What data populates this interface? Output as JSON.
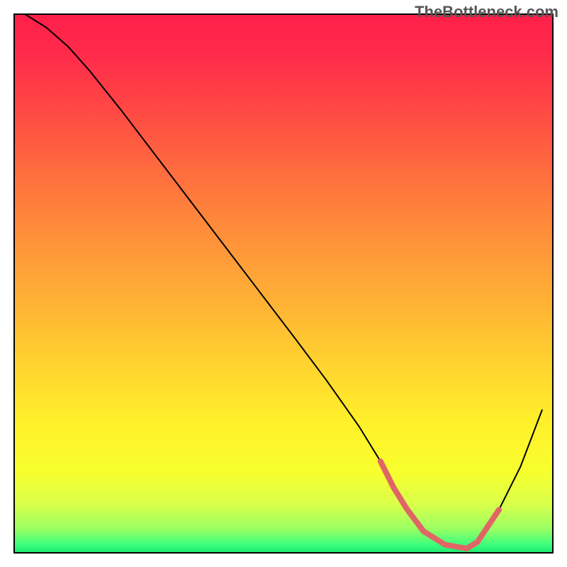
{
  "watermark": "TheBottleneck.com",
  "chart_data": {
    "type": "line",
    "title": "",
    "xlabel": "",
    "ylabel": "",
    "xlim": [
      0,
      100
    ],
    "ylim": [
      0,
      100
    ],
    "background_gradient_stops": [
      {
        "offset": 0.0,
        "color": "#ff1f4a"
      },
      {
        "offset": 0.08,
        "color": "#ff2c4a"
      },
      {
        "offset": 0.18,
        "color": "#ff4944"
      },
      {
        "offset": 0.3,
        "color": "#ff6f3e"
      },
      {
        "offset": 0.42,
        "color": "#ff923a"
      },
      {
        "offset": 0.55,
        "color": "#ffb634"
      },
      {
        "offset": 0.66,
        "color": "#ffd62e"
      },
      {
        "offset": 0.76,
        "color": "#fff02a"
      },
      {
        "offset": 0.85,
        "color": "#f7ff2d"
      },
      {
        "offset": 0.91,
        "color": "#d9ff4a"
      },
      {
        "offset": 0.955,
        "color": "#9bff63"
      },
      {
        "offset": 0.985,
        "color": "#3cff7d"
      },
      {
        "offset": 1.0,
        "color": "#18e86f"
      }
    ],
    "series": [
      {
        "name": "bottleneck-curve",
        "color": "#000000",
        "stroke_width": 2,
        "x": [
          2.0,
          6.0,
          10.0,
          14.0,
          20.0,
          28.0,
          36.0,
          44.0,
          52.0,
          58.0,
          64.0,
          68.0,
          70.5,
          73.0,
          76.0,
          80.0,
          84.0,
          86.0,
          90.0,
          94.0,
          98.0
        ],
        "values": [
          100.0,
          97.5,
          94.0,
          89.5,
          82.0,
          71.5,
          61.0,
          50.5,
          40.0,
          32.0,
          23.5,
          17.0,
          12.0,
          8.0,
          4.0,
          1.5,
          0.8,
          2.0,
          8.0,
          16.0,
          26.5
        ]
      },
      {
        "name": "highlighted-bottom-segment",
        "color": "#e06666",
        "stroke_width": 8,
        "x": [
          68.0,
          70.5,
          73.0,
          76.0,
          80.0,
          84.0,
          86.0,
          90.0
        ],
        "values": [
          17.0,
          12.0,
          8.0,
          4.0,
          1.5,
          0.8,
          2.0,
          8.0
        ]
      }
    ]
  }
}
